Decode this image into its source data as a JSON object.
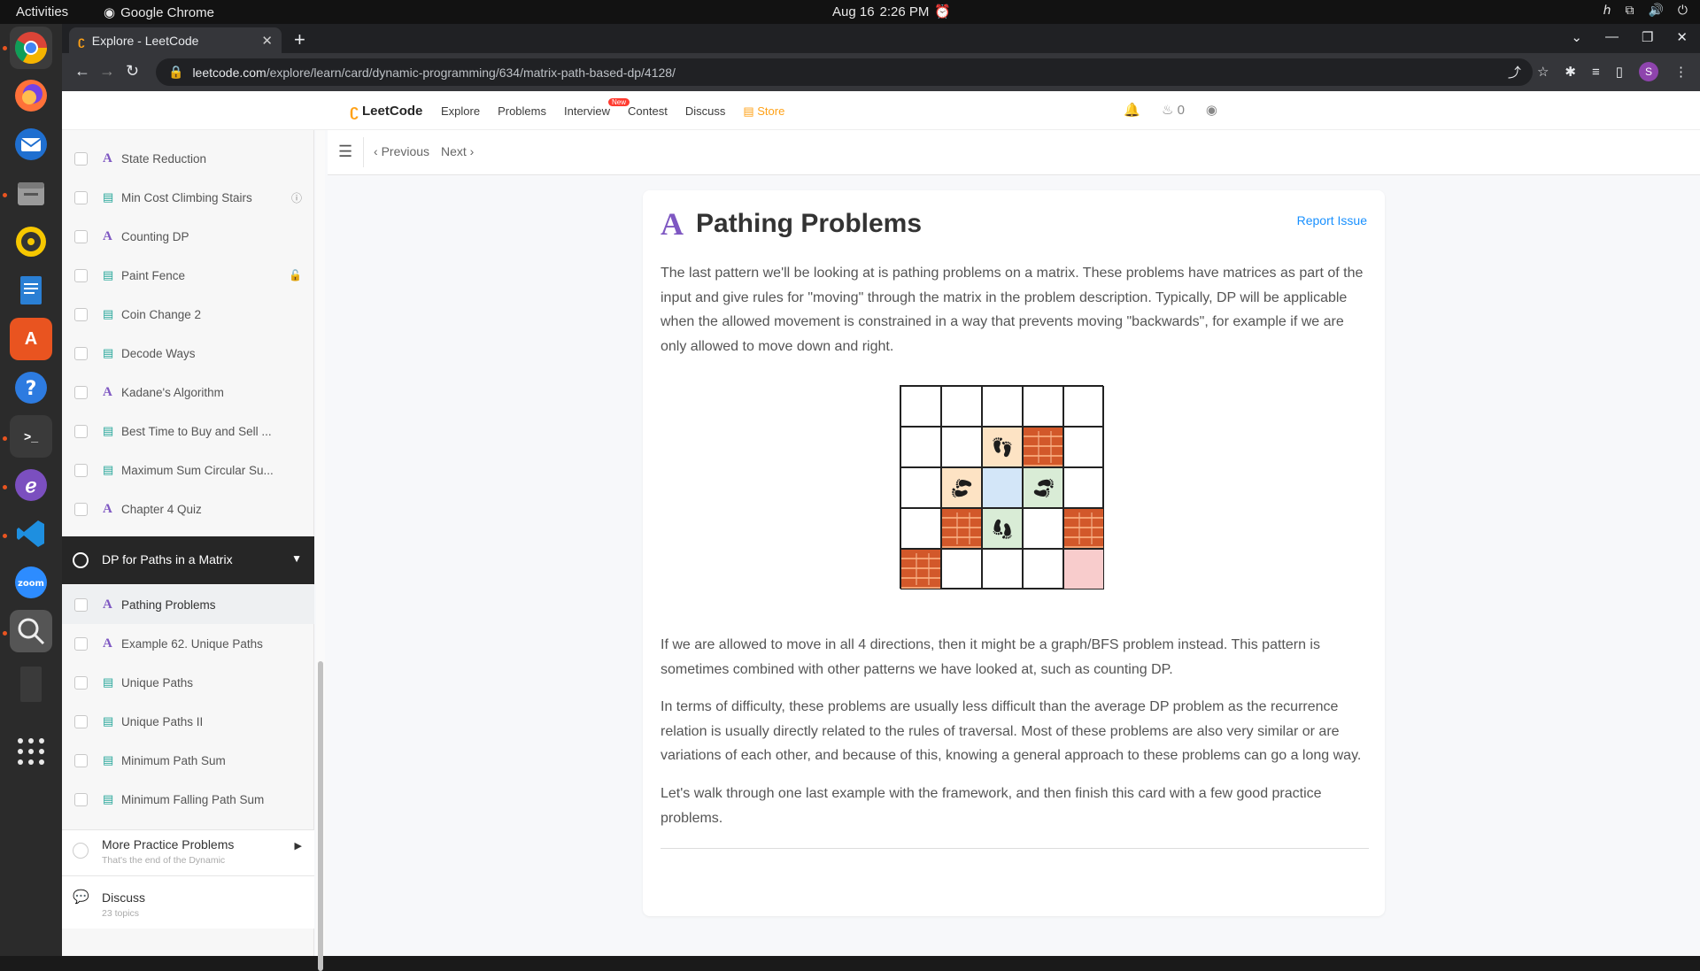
{
  "os": {
    "activities": "Activities",
    "app_name": "Google Chrome",
    "date": "Aug 16",
    "time": "2:26 PM"
  },
  "browser": {
    "tab_title": "Explore - LeetCode",
    "url_domain": "leetcode.com",
    "url_path": "/explore/learn/card/dynamic-programming/634/matrix-path-based-dp/4128/",
    "profile_initial": "S"
  },
  "leetcode_nav": {
    "logo": "LeetCode",
    "links": [
      "Explore",
      "Problems",
      "Interview",
      "Contest",
      "Discuss"
    ],
    "store": "Store",
    "new_badge": "New",
    "streak": "0"
  },
  "toolbar": {
    "previous": "Previous",
    "next": "Next"
  },
  "sidebar": {
    "items_top": [
      {
        "type": "article",
        "label": "State Reduction",
        "badge": ""
      },
      {
        "type": "doc",
        "label": "Min Cost Climbing Stairs",
        "badge": "info"
      },
      {
        "type": "article",
        "label": "Counting DP",
        "badge": ""
      },
      {
        "type": "doc",
        "label": "Paint Fence",
        "badge": "lock"
      },
      {
        "type": "doc",
        "label": "Coin Change 2",
        "badge": ""
      },
      {
        "type": "doc",
        "label": "Decode Ways",
        "badge": ""
      },
      {
        "type": "article",
        "label": "Kadane's Algorithm",
        "badge": ""
      },
      {
        "type": "doc",
        "label": "Best Time to Buy and Sell ...",
        "badge": ""
      },
      {
        "type": "doc",
        "label": "Maximum Sum Circular Su...",
        "badge": ""
      },
      {
        "type": "article",
        "label": "Chapter 4 Quiz",
        "badge": ""
      }
    ],
    "chapter": "DP for Paths in a Matrix",
    "items_bottom": [
      {
        "type": "article",
        "label": "Pathing Problems",
        "active": true
      },
      {
        "type": "article",
        "label": "Example 62. Unique Paths",
        "active": false
      },
      {
        "type": "doc",
        "label": "Unique Paths",
        "active": false
      },
      {
        "type": "doc",
        "label": "Unique Paths II",
        "active": false
      },
      {
        "type": "doc",
        "label": "Minimum Path Sum",
        "active": false
      },
      {
        "type": "doc",
        "label": "Minimum Falling Path Sum",
        "active": false
      }
    ],
    "more": {
      "title": "More Practice Problems",
      "subtitle": "That's the end of the Dynamic"
    },
    "discuss": {
      "title": "Discuss",
      "subtitle": "23 topics"
    }
  },
  "article": {
    "title": "Pathing Problems",
    "report": "Report Issue",
    "p1": "The last pattern we'll be looking at is pathing problems on a matrix. These problems have matrices as part of the input and give rules for \"moving\" through the matrix in the problem description. Typically, DP will be applicable when the allowed movement is constrained in a way that prevents moving \"backwards\", for example if we are only allowed to move down and right.",
    "p2": "If we are allowed to move in all 4 directions, then it might be a graph/BFS problem instead. This pattern is sometimes combined with other patterns we have looked at, such as counting DP.",
    "p3": "In terms of difficulty, these problems are usually less difficult than the average DP problem as the recurrence relation is usually directly related to the rules of traversal. Most of these problems are also very similar or are variations of each other, and because of this, knowing a general approach to these problems can go a long way.",
    "p4": "Let's walk through one last example with the framework, and then finish this card with a few good practice problems.",
    "grid": [
      [
        "",
        "",
        "",
        "",
        ""
      ],
      [
        "",
        "",
        "foot-up",
        "brick",
        ""
      ],
      [
        "",
        "foot-left",
        "blue",
        "foot-right",
        ""
      ],
      [
        "",
        "brick",
        "foot-down",
        "",
        "brick"
      ],
      [
        "brick",
        "",
        "",
        "",
        "pink"
      ]
    ]
  }
}
